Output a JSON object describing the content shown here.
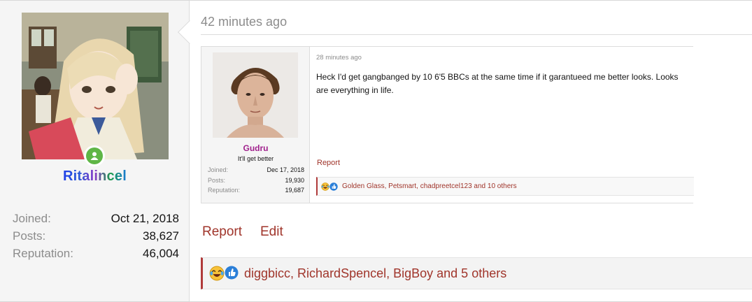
{
  "post": {
    "timestamp": "42 minutes ago",
    "author": {
      "username": "Ritalincel",
      "avatar_icon": "anime-girl-avatar",
      "online_icon": "online-user-icon",
      "stats": [
        {
          "label": "Joined:",
          "value": "Oct 21, 2018"
        },
        {
          "label": "Posts:",
          "value": "38,627"
        },
        {
          "label": "Reputation:",
          "value": "46,004"
        }
      ]
    },
    "actions": {
      "report": "Report",
      "edit": "Edit"
    },
    "reactions": {
      "icons": [
        "laughing-crying-reaction-icon",
        "thumbs-up-reaction-icon"
      ],
      "text": "diggbicc, RichardSpencel, BigBoy and 5 others"
    }
  },
  "quote": {
    "timestamp": "28 minutes ago",
    "author": {
      "username": "Gudru",
      "user_title": "It'll get better",
      "avatar_icon": "man-portrait-avatar",
      "stats": [
        {
          "label": "Joined:",
          "value": "Dec 17, 2018"
        },
        {
          "label": "Posts:",
          "value": "19,930"
        },
        {
          "label": "Reputation:",
          "value": "19,687"
        }
      ]
    },
    "body": "Heck I'd get gangbanged by 10 6'5 BBCs at the same time if it garantueed me better looks. Looks are everything in life.",
    "report": "Report",
    "reactions": {
      "icons": [
        "laughing-crying-reaction-icon",
        "thumbs-up-reaction-icon"
      ],
      "text": "Golden Glass, Petsmart, chadpreetcel123 and 10 others"
    }
  },
  "colors": {
    "link": "#a0352b",
    "online": "#5fb646",
    "quoted_username": "#a0208c",
    "reaction_border": "#b03a3a"
  }
}
